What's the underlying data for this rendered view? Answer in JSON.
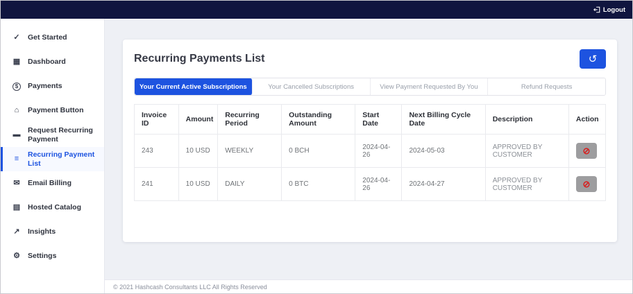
{
  "topbar": {
    "logout_label": "Logout"
  },
  "sidebar": {
    "items": [
      {
        "label": "Get Started",
        "icon": "clipboard-check-icon",
        "active": false
      },
      {
        "label": "Dashboard",
        "icon": "grid-icon",
        "active": false
      },
      {
        "label": "Payments",
        "icon": "dollar-circle-icon",
        "active": false
      },
      {
        "label": "Payment Button",
        "icon": "bank-icon",
        "active": false
      },
      {
        "label": "Request Recurring Payment",
        "icon": "card-icon",
        "active": false
      },
      {
        "label": "Recurring Payment List",
        "icon": "list-icon",
        "active": true
      },
      {
        "label": "Email Billing",
        "icon": "document-icon",
        "active": false
      },
      {
        "label": "Hosted Catalog",
        "icon": "catalog-icon",
        "active": false
      },
      {
        "label": "Insights",
        "icon": "chart-icon",
        "active": false
      },
      {
        "label": "Settings",
        "icon": "gear-icon",
        "active": false
      }
    ]
  },
  "main": {
    "title": "Recurring Payments List",
    "tabs": [
      {
        "label": "Your Current Active Subscriptions",
        "active": true
      },
      {
        "label": "Your Cancelled Subscriptions",
        "active": false
      },
      {
        "label": "View Payment Requested By You",
        "active": false
      },
      {
        "label": "Refund Requests",
        "active": false
      }
    ],
    "table": {
      "headers": [
        "Invoice ID",
        "Amount",
        "Recurring Period",
        "Outstanding Amount",
        "Start Date",
        "Next Billing Cycle Date",
        "Description",
        "Action"
      ],
      "rows": [
        [
          "243",
          "10 USD",
          "WEEKLY",
          "0 BCH",
          "2024-04-26",
          "2024-05-03",
          "APPROVED BY CUSTOMER"
        ],
        [
          "241",
          "10 USD",
          "DAILY",
          "0 BTC",
          "2024-04-26",
          "2024-04-27",
          "APPROVED BY CUSTOMER"
        ]
      ]
    }
  },
  "footer": {
    "copyright": "© 2021 Hashcash Consultants LLC All Rights Reserved"
  },
  "colors": {
    "topbar_bg": "#10153f",
    "accent_blue": "#1d53e0",
    "action_button_bg": "#9d9d9f",
    "action_icon_red": "#d81f1f"
  }
}
